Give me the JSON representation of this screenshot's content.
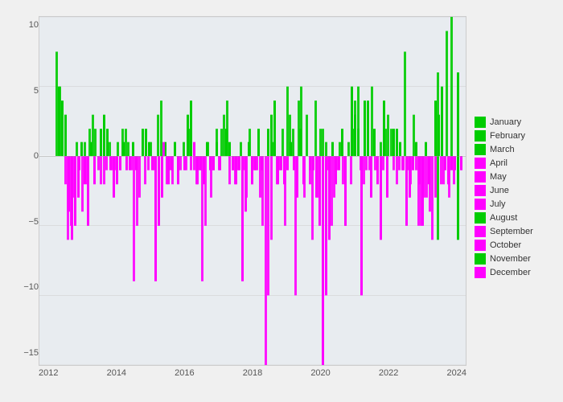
{
  "chart": {
    "title": "",
    "background_color": "#e8ecf0",
    "plot_area_color": "#e8ecf0",
    "y_axis": {
      "min": -15,
      "max": 10,
      "ticks": [
        10,
        5,
        0,
        -5,
        -10,
        -15
      ],
      "label": ""
    },
    "x_axis": {
      "ticks": [
        "2012",
        "2014",
        "2016",
        "2018",
        "2020",
        "2022",
        "2024"
      ]
    },
    "colors": {
      "green": "#00cc00",
      "magenta": "#ff00ff"
    }
  },
  "legend": {
    "items": [
      {
        "label": "January",
        "color": "#00cc00"
      },
      {
        "label": "February",
        "color": "#00cc00"
      },
      {
        "label": "March",
        "color": "#00cc00"
      },
      {
        "label": "April",
        "color": "#ff00ff"
      },
      {
        "label": "May",
        "color": "#ff00ff"
      },
      {
        "label": "June",
        "color": "#ff00ff"
      },
      {
        "label": "July",
        "color": "#ff00ff"
      },
      {
        "label": "August",
        "color": "#00cc00"
      },
      {
        "label": "September",
        "color": "#ff00ff"
      },
      {
        "label": "October",
        "color": "#ff00ff"
      },
      {
        "label": "November",
        "color": "#00cc00"
      },
      {
        "label": "December",
        "color": "#ff00ff"
      }
    ]
  }
}
